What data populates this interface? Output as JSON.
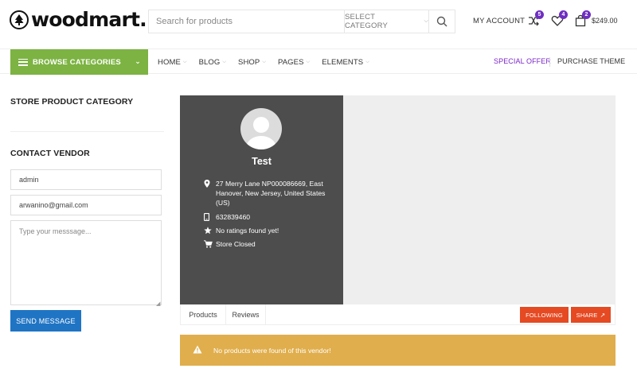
{
  "header": {
    "logo_text": "woodmart.",
    "search": {
      "placeholder": "Search for products",
      "category_label": "SELECT CATEGORY"
    },
    "my_account_label": "MY ACCOUNT",
    "compare_count": "5",
    "wishlist_count": "4",
    "cart_count": "2",
    "cart_total": "$249.00",
    "accent_color": "#6f2ec2"
  },
  "nav": {
    "browse_label": "BROWSE CATEGORIES",
    "browse_color": "#7cb342",
    "items": [
      "HOME",
      "BLOG",
      "SHOP",
      "PAGES",
      "ELEMENTS"
    ],
    "special_offer_label": "SPECIAL OFFER",
    "purchase_theme_label": "PURCHASE THEME"
  },
  "sidebar": {
    "category_title": "STORE PRODUCT CATEGORY",
    "contact_title": "CONTACT VENDOR",
    "name_value": "admin",
    "email_value": "arwanino@gmail.com",
    "message_placeholder": "Type your messsage...",
    "send_label": "SEND MESSAGE",
    "send_color": "#1f74c4"
  },
  "store": {
    "name": "Test",
    "address": "27 Merry Lane NP000086669, East Hanover, New Jersey, United States (US)",
    "phone": "632839460",
    "rating": "No ratings found yet!",
    "status": "Store Closed",
    "tabs": [
      "Products",
      "Reviews"
    ],
    "following_label": "FOLLOWING",
    "share_label": "SHARE",
    "button_color": "#e54a23",
    "notice": "No products were found of this vendor!",
    "notice_color": "#e0ae4c"
  }
}
